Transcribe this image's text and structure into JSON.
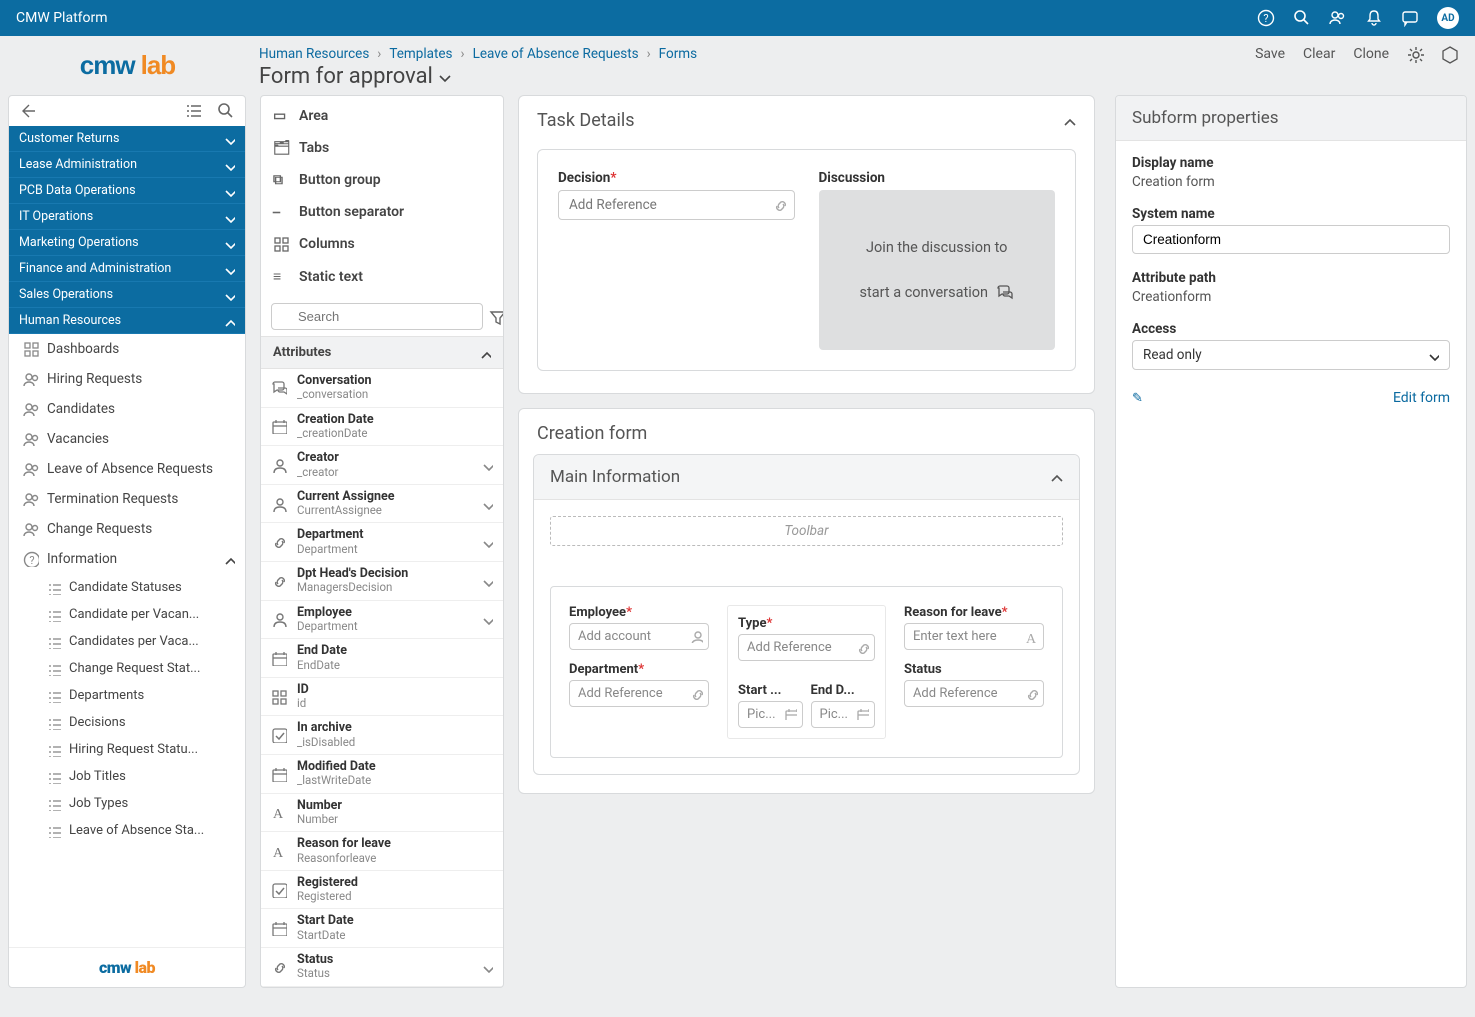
{
  "topbar": {
    "title": "CMW Platform",
    "avatar": "AD"
  },
  "logo": {
    "a": "cmw",
    "b": "lab"
  },
  "breadcrumbs": [
    "Human Resources",
    "Templates",
    "Leave of Absence Requests",
    "Forms"
  ],
  "page_title": "Form for approval",
  "page_actions": {
    "save": "Save",
    "clear": "Clear",
    "clone": "Clone"
  },
  "sidebar": {
    "accordions": [
      "Customer Returns",
      "Lease Administration",
      "PCB Data Operations",
      "IT Operations",
      "Marketing Operations",
      "Finance and Administration",
      "Sales Operations",
      "Human Resources"
    ],
    "hr_items": [
      "Dashboards",
      "Hiring Requests",
      "Candidates",
      "Vacancies",
      "Leave of Absence Requests",
      "Termination Requests",
      "Change Requests",
      "Information"
    ],
    "info_items": [
      "Candidate Statuses",
      "Candidate per Vacan...",
      "Candidates per Vaca...",
      "Change Request Stat...",
      "Departments",
      "Decisions",
      "Hiring Request Statu...",
      "Job Titles",
      "Job Types",
      "Leave of Absence Sta..."
    ]
  },
  "components": {
    "items": [
      "Area",
      "Tabs",
      "Button group",
      "Button separator",
      "Columns",
      "Static text"
    ],
    "search_ph": "Search",
    "attr_head": "Attributes",
    "attrs": [
      {
        "name": "Conversation",
        "sys": "_conversation",
        "icon": "chat",
        "exp": false
      },
      {
        "name": "Creation Date",
        "sys": "_creationDate",
        "icon": "date",
        "exp": false
      },
      {
        "name": "Creator",
        "sys": "_creator",
        "icon": "user",
        "exp": true
      },
      {
        "name": "Current Assignee",
        "sys": "CurrentAssignee",
        "icon": "user",
        "exp": true
      },
      {
        "name": "Department",
        "sys": "Department",
        "icon": "link",
        "exp": true
      },
      {
        "name": "Dpt Head's Decision",
        "sys": "ManagersDecision",
        "icon": "link",
        "exp": true
      },
      {
        "name": "Employee",
        "sys": "Department",
        "icon": "user",
        "exp": true
      },
      {
        "name": "End Date",
        "sys": "EndDate",
        "icon": "date",
        "exp": false
      },
      {
        "name": "ID",
        "sys": "id",
        "icon": "id",
        "exp": false
      },
      {
        "name": "In archive",
        "sys": "_isDisabled",
        "icon": "check",
        "exp": false
      },
      {
        "name": "Modified Date",
        "sys": "_lastWriteDate",
        "icon": "date",
        "exp": false
      },
      {
        "name": "Number",
        "sys": "Number",
        "icon": "num",
        "exp": false
      },
      {
        "name": "Reason for leave",
        "sys": "Reasonforleave",
        "icon": "text",
        "exp": false
      },
      {
        "name": "Registered",
        "sys": "Registered",
        "icon": "check",
        "exp": false
      },
      {
        "name": "Start Date",
        "sys": "StartDate",
        "icon": "date",
        "exp": false
      },
      {
        "name": "Status",
        "sys": "Status",
        "icon": "link",
        "exp": true
      }
    ]
  },
  "canvas": {
    "task_head": "Task Details",
    "decision": {
      "label": "Decision",
      "ph": "Add Reference"
    },
    "discussion": {
      "label": "Discussion",
      "l1": "Join the discussion to",
      "l2": "start a conversation"
    },
    "subform_title": "Creation form",
    "maininfo_head": "Main Information",
    "toolbar_ph": "Toolbar",
    "fields": {
      "employee": {
        "label": "Employee",
        "ph": "Add account"
      },
      "type": {
        "label": "Type",
        "ph": "Add Reference"
      },
      "reason": {
        "label": "Reason for leave",
        "ph": "Enter text here"
      },
      "department": {
        "label": "Department",
        "ph": "Add Reference"
      },
      "status": {
        "label": "Status",
        "ph": "Add Reference"
      },
      "start": {
        "label": "Start ...",
        "ph": "Pic..."
      },
      "end": {
        "label": "End D...",
        "ph": "Pic..."
      }
    }
  },
  "props": {
    "head": "Subform properties",
    "display_label": "Display name",
    "display_val": "Creation form",
    "sys_label": "System name",
    "sys_val": "Creationform",
    "path_label": "Attribute path",
    "path_val": "Creationform",
    "access_label": "Access",
    "access_val": "Read only",
    "edit": "Edit form"
  }
}
